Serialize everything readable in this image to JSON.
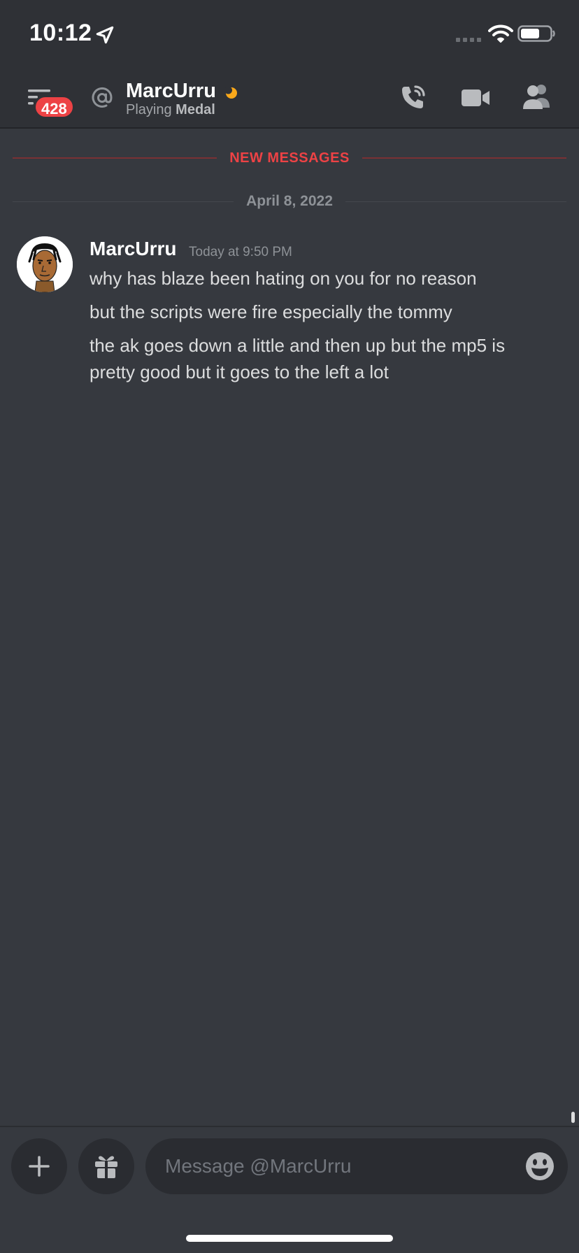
{
  "status_bar": {
    "time": "10:12",
    "location_icon": "location-arrow-icon",
    "signal_icon": "cellular-signal-icon",
    "wifi_icon": "wifi-icon",
    "battery_icon": "battery-icon"
  },
  "header": {
    "menu_icon": "hamburger-menu-icon",
    "unread_badge": "428",
    "channel_icon": "at-sign-icon",
    "title": "MarcUrru",
    "status_icon": "idle-moon-icon",
    "activity_prefix": "Playing",
    "activity_name": "Medal",
    "actions": [
      "phone-call-icon",
      "video-camera-icon",
      "members-icon"
    ]
  },
  "divider": {
    "new_messages": "NEW MESSAGES",
    "date": "April 8, 2022"
  },
  "message_group": {
    "author": "MarcUrru",
    "timestamp": "Today at 9:50 PM",
    "messages": [
      "why has blaze been hating on you for no reason",
      "but the scripts were fire especially the tommy",
      "the ak goes down a little and then up but the mp5 is pretty good but it goes to the left a lot"
    ]
  },
  "composer": {
    "placeholder": "Message @MarcUrru",
    "plus_icon": "plus-icon",
    "gift_icon": "gift-icon",
    "emoji_icon": "emoji-icon"
  },
  "colors": {
    "background": "#36393f",
    "header": "#2f3136",
    "accent_red": "#ed4245",
    "idle": "#faa81a"
  }
}
